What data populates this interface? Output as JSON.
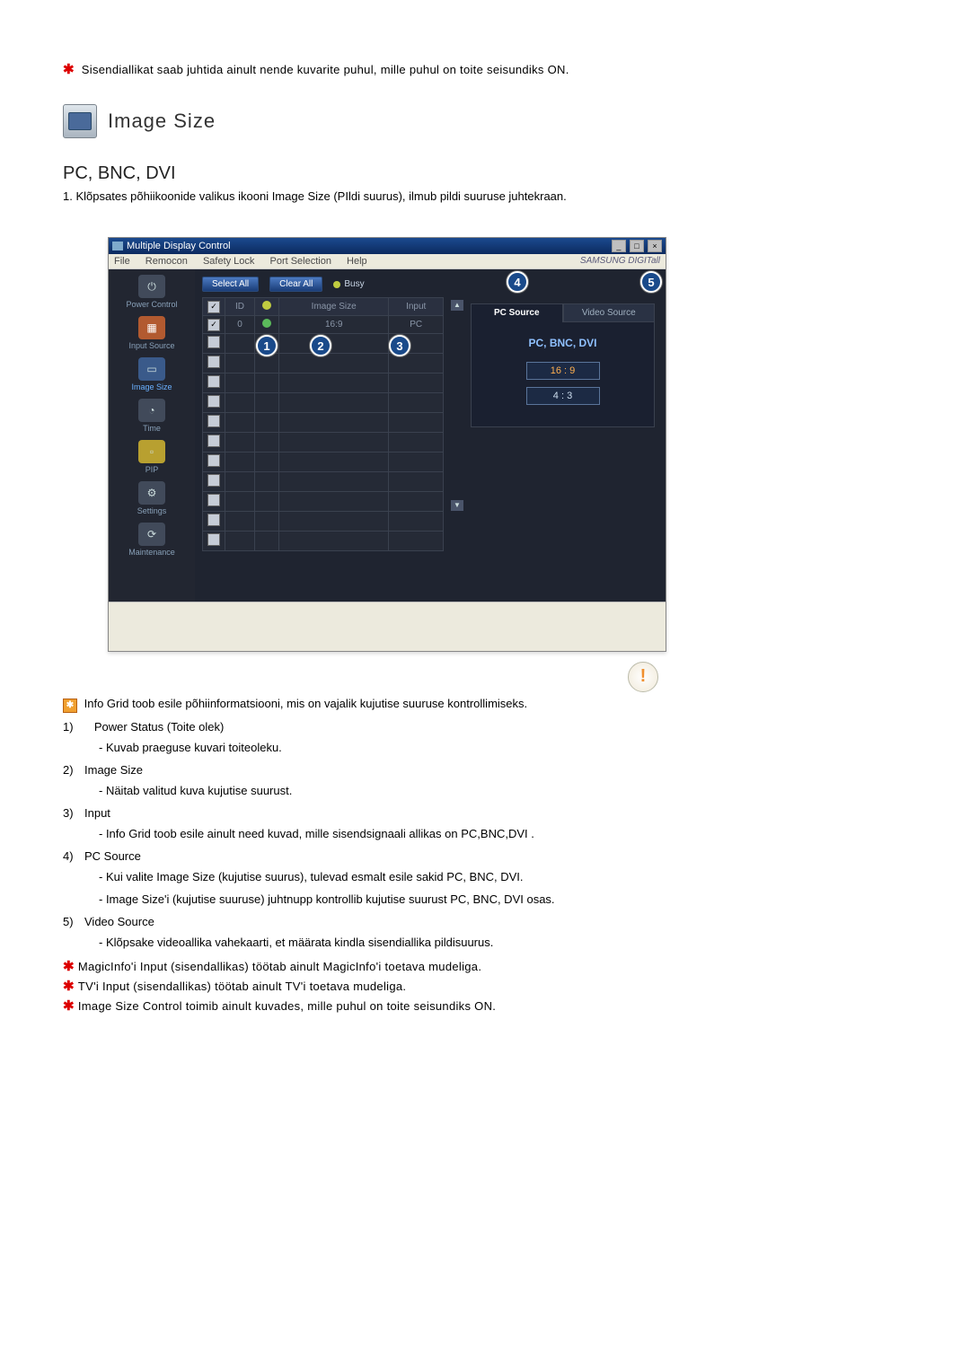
{
  "top_note": "Sisendiallikat saab juhtida ainult nende kuvarite puhul, mille puhul on toite seisundiks ON.",
  "section_title": "Image Size",
  "subheading": "PC, BNC, DVI",
  "intro_line": "1.  Klõpsates põhiikoonide valikus ikooni Image Size (PIldi suurus), ilmub pildi suuruse juhtekraan.",
  "app": {
    "title": "Multiple Display Control",
    "menu": [
      "File",
      "Remocon",
      "Safety Lock",
      "Port Selection",
      "Help"
    ],
    "brand": "SAMSUNG DIGITall",
    "sidebar": [
      {
        "label": "Power Control",
        "active": false,
        "icon": "⏻"
      },
      {
        "label": "Input Source",
        "active": false,
        "icon": "▦"
      },
      {
        "label": "Image Size",
        "active": true,
        "icon": "▭"
      },
      {
        "label": "Time",
        "active": false,
        "icon": "◔"
      },
      {
        "label": "PIP",
        "active": false,
        "icon": "▫"
      },
      {
        "label": "Settings",
        "active": false,
        "icon": "⚙"
      },
      {
        "label": "Maintenance",
        "active": false,
        "icon": "⟳"
      }
    ],
    "buttons": {
      "select_all": "Select All",
      "clear_all": "Clear All",
      "busy": "Busy"
    },
    "grid": {
      "headers": {
        "chk": "☑",
        "id": "ID",
        "status": "●",
        "img": "Image Size",
        "input": "Input"
      },
      "row0": {
        "id": "0",
        "img": "16:9",
        "input": "PC"
      }
    },
    "tabs": {
      "pc": "PC Source",
      "video": "Video Source"
    },
    "panel": {
      "title": "PC, BNC, DVI",
      "r169": "16 : 9",
      "r43": "4 : 3"
    },
    "callouts": {
      "c1": "1",
      "c2": "2",
      "c3": "3",
      "c4": "4",
      "c5": "5"
    }
  },
  "info_grid_line": "Info Grid toob esile põhiinformatsiooni, mis on vajalik kujutise suuruse kontrollimiseks.",
  "defs": [
    {
      "n": "1)",
      "title": "Power Status (Toite olek)",
      "lines": [
        "- Kuvab praeguse kuvari toiteoleku."
      ]
    },
    {
      "n": "2)",
      "title": "Image Size",
      "lines": [
        "- Näitab valitud kuva kujutise suurust."
      ]
    },
    {
      "n": "3)",
      "title": "Input",
      "lines": [
        "- Info Grid toob esile ainult need kuvad, mille sisendsignaali allikas on PC,BNC,DVI ."
      ]
    },
    {
      "n": "4)",
      "title": "PC Source",
      "lines": [
        "- Kui valite Image Size (kujutise suurus), tulevad esmalt esile sakid PC, BNC, DVI.",
        "- Image Size'i (kujutise suuruse) juhtnupp kontrollib kujutise suurust PC, BNC, DVI osas."
      ]
    },
    {
      "n": "5)",
      "title": "Video Source",
      "lines": [
        "- Klõpsake videoallika vahekaarti, et määrata kindla sisendiallika pildisuurus."
      ]
    }
  ],
  "footnotes": [
    "MagicInfo'i Input (sisendallikas) töötab ainult MagicInfo'i toetava mudeliga.",
    "TV'i Input (sisendallikas) töötab ainult TV'i toetava mudeliga.",
    "Image Size Control toimib ainult kuvades, mille puhul on toite seisundiks ON."
  ]
}
